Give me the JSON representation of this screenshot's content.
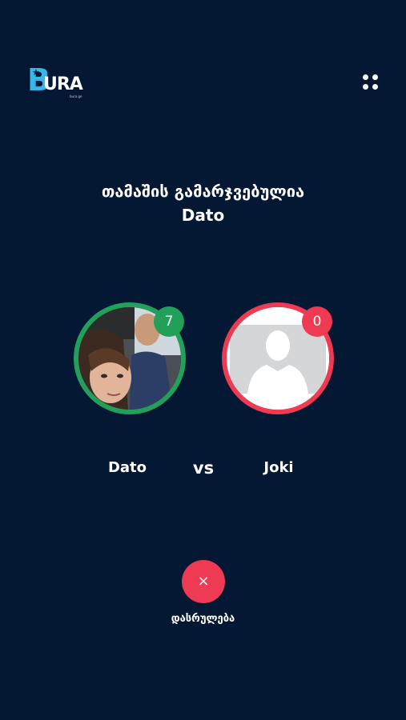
{
  "header": {
    "logo_letter": "B",
    "logo_text": "URA",
    "logo_subtext": "bura.ge",
    "logo_icon": "star-icon",
    "menu_icon": "grid-dots-icon"
  },
  "result": {
    "title_line1": "თამაშის გამარჯვებულია",
    "winner_name": "Dato"
  },
  "players": {
    "left": {
      "name": "Dato",
      "score": "7",
      "ring_color": "#22a05a",
      "avatar": "user-photo"
    },
    "right": {
      "name": "Joki",
      "score": "0",
      "ring_color": "#ee3a52",
      "avatar": "default-person-icon"
    }
  },
  "vs_label": "vs",
  "finish": {
    "icon_glyph": "×",
    "label": "დასრულება",
    "color": "#ee3a52"
  },
  "colors": {
    "background": "#041833",
    "accent_blue": "#38b6e8"
  }
}
